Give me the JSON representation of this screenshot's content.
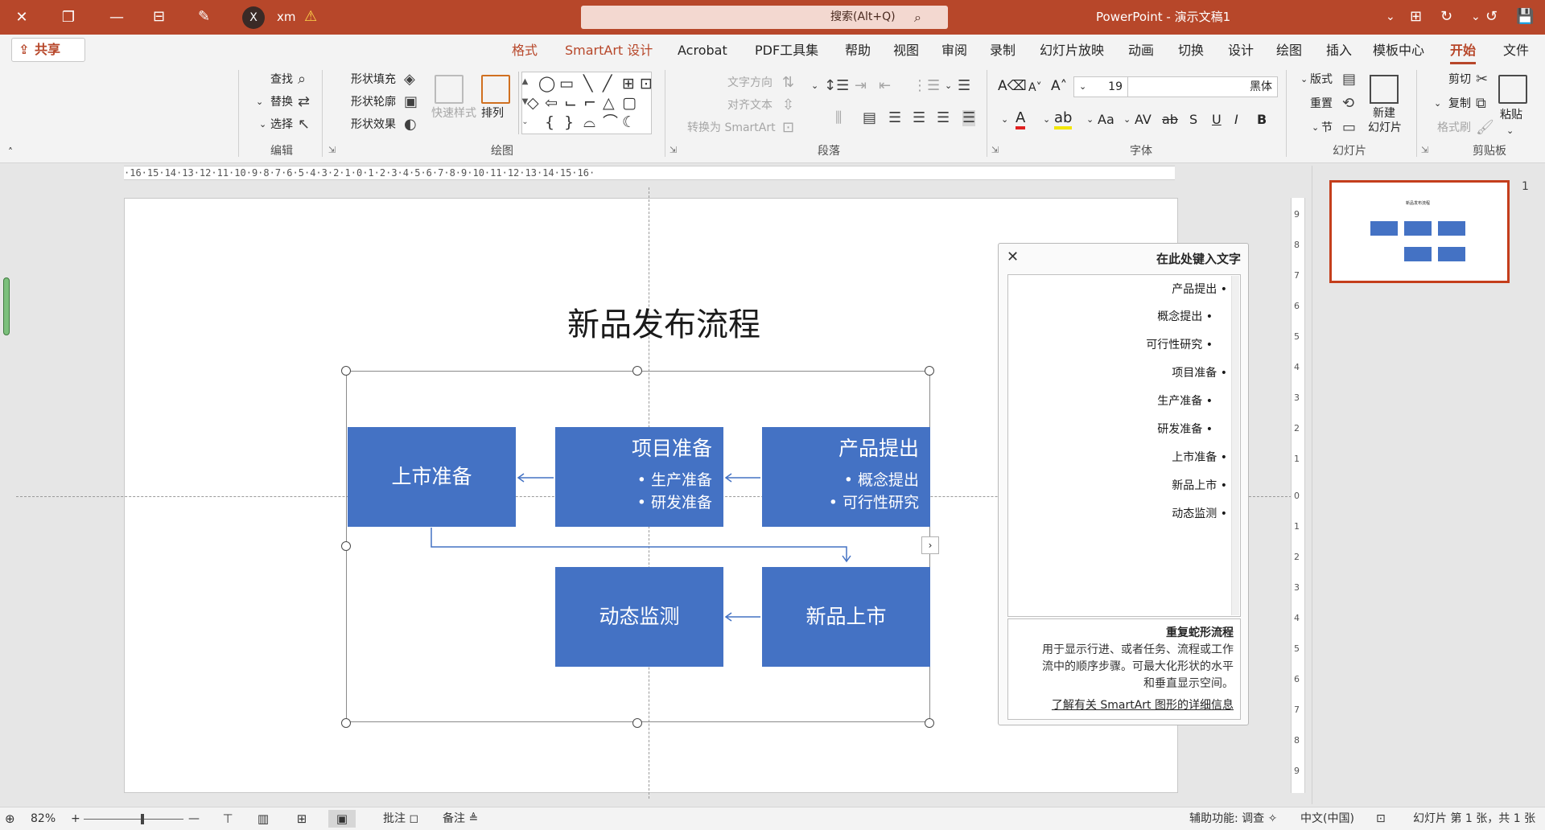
{
  "window": {
    "app_name": "PowerPoint",
    "doc_name": "演示文稿1",
    "separator": " - ",
    "user_initial": "X",
    "user_name": "xm",
    "search_label": "搜索(Alt+Q)",
    "controls": {
      "minimize": "—",
      "restore": "❐",
      "close": "✕"
    }
  },
  "ribbon_tabs": [
    {
      "label": "文件"
    },
    {
      "label": "开始",
      "active": true
    },
    {
      "label": "模板中心"
    },
    {
      "label": "插入"
    },
    {
      "label": "绘图"
    },
    {
      "label": "设计"
    },
    {
      "label": "切换"
    },
    {
      "label": "动画"
    },
    {
      "label": "幻灯片放映"
    },
    {
      "label": "录制"
    },
    {
      "label": "审阅"
    },
    {
      "label": "视图"
    },
    {
      "label": "帮助"
    },
    {
      "label": "PDF工具集"
    },
    {
      "label": "Acrobat"
    },
    {
      "label": "SmartArt 设计",
      "contextual": true
    },
    {
      "label": "格式",
      "contextual": true
    }
  ],
  "share_label": "共享",
  "ribbon": {
    "clipboard": {
      "label": "剪贴板",
      "paste": "粘贴",
      "cut": "剪切",
      "copy": "复制",
      "format_painter": "格式刷"
    },
    "slides": {
      "label": "幻灯片",
      "new_slide": "新建",
      "new_slide_sub": "幻灯片",
      "layout": "版式",
      "reset": "重置",
      "section": "节"
    },
    "font": {
      "label": "字体",
      "font_name": "黑体",
      "font_size": "19",
      "buttons": [
        "B",
        "I",
        "U",
        "S",
        "ab",
        "AV",
        "Aa",
        "A",
        "A"
      ]
    },
    "paragraph": {
      "label": "段落",
      "text_direction": "文字方向",
      "align_text": "对齐文本",
      "convert_smartart": "转换为 SmartArt"
    },
    "drawing": {
      "label": "绘图",
      "arrange": "排列",
      "quick_styles": "快速样式",
      "shape_fill": "形状填充",
      "shape_outline": "形状轮廓",
      "shape_effects": "形状效果"
    },
    "editing": {
      "label": "编辑",
      "find": "查找",
      "replace": "替换",
      "select": "选择"
    }
  },
  "ruler_h": "·16·15·14·13·12·11·10·9·8·7·6·5·4·3·2·1·0·1·2·3·4·5·6·7·8·9·10·11·12·13·14·15·16·",
  "ruler_v": [
    "9",
    "8",
    "7",
    "6",
    "5",
    "4",
    "3",
    "2",
    "1",
    "0",
    "1",
    "2",
    "3",
    "4",
    "5",
    "6",
    "7",
    "8",
    "9"
  ],
  "slide": {
    "title": "新品发布流程",
    "boxes": [
      {
        "id": "b1",
        "title": "产品提出",
        "bullets": [
          "概念提出",
          "可行性研究"
        ]
      },
      {
        "id": "b2",
        "title": "项目准备",
        "bullets": [
          "生产准备",
          "研发准备"
        ]
      },
      {
        "id": "b3",
        "title": "上市准备",
        "bullets": []
      },
      {
        "id": "b4",
        "title": "新品上市",
        "bullets": []
      },
      {
        "id": "b5",
        "title": "动态监测",
        "bullets": []
      }
    ],
    "fill_color": "#4472c4"
  },
  "text_pane": {
    "title": "在此处键入文字",
    "items": [
      {
        "text": "产品提出",
        "level": 1
      },
      {
        "text": "概念提出",
        "level": 2
      },
      {
        "text": "可行性研究",
        "level": 2
      },
      {
        "text": "项目准备",
        "level": 1
      },
      {
        "text": "生产准备",
        "level": 2
      },
      {
        "text": "研发准备",
        "level": 2
      },
      {
        "text": "上市准备",
        "level": 1
      },
      {
        "text": "新品上市",
        "level": 1
      },
      {
        "text": "动态监测",
        "level": 1
      }
    ],
    "desc_title": "重复蛇形流程",
    "desc_lines": [
      "用于显示行进、或者任务、流程或工作",
      "流中的顺序步骤。可最大化形状的水平",
      "和垂直显示空间。"
    ],
    "learn_more": "了解有关 SmartArt 图形的详细信息"
  },
  "thumbnail": {
    "number": "1",
    "title": "新品发布流程"
  },
  "status": {
    "slide_info": "幻灯片 第 1 张，共 1 张",
    "language": "中文(中国)",
    "accessibility": "辅助功能: 调查",
    "notes": "备注",
    "comments": "批注",
    "zoom": "82%",
    "zoom_minus": "—",
    "zoom_plus": "+"
  },
  "colors": {
    "accent": "#b7472a",
    "smartart_fill": "#4472c4"
  }
}
